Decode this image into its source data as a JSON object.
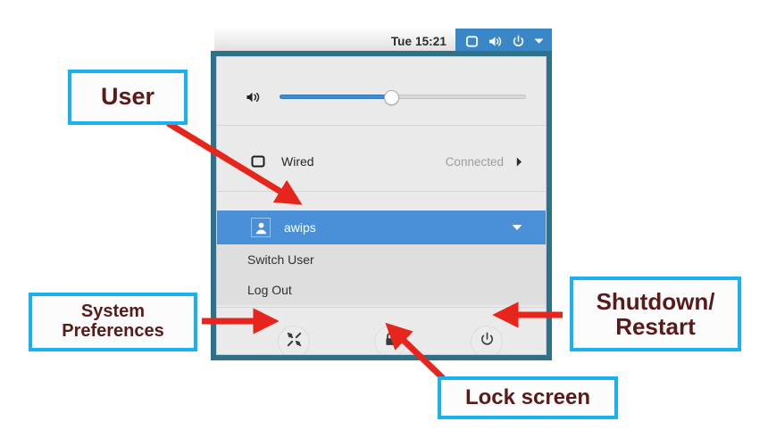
{
  "topbar": {
    "clock": "Tue 15:21",
    "indicators": [
      {
        "name": "network-monitor-icon",
        "label": "network"
      },
      {
        "name": "volume-speaker-icon",
        "label": "volume"
      },
      {
        "name": "power-icon",
        "label": "power"
      },
      {
        "name": "chevron-down-icon",
        "label": "menu"
      }
    ]
  },
  "menu": {
    "volume": {
      "icon_name": "speaker-icon",
      "level_percent": 45
    },
    "network": {
      "icon_name": "wired-network-icon",
      "label": "Wired",
      "status": "Connected",
      "arrow_icon": "chevron-right-icon"
    },
    "user": {
      "avatar_icon": "user-avatar-icon",
      "name": "awips",
      "expand_icon": "chevron-down-icon",
      "submenu": [
        {
          "label": "Switch User"
        },
        {
          "label": "Log Out"
        }
      ]
    },
    "actions": [
      {
        "name": "system-preferences-button",
        "icon": "tools-icon",
        "title": "System Preferences"
      },
      {
        "name": "lock-screen-button",
        "icon": "lock-icon",
        "title": "Lock Screen"
      },
      {
        "name": "shutdown-button",
        "icon": "power-icon",
        "title": "Shutdown"
      }
    ]
  },
  "annotations": {
    "user": "User",
    "system_preferences_line1": "System",
    "system_preferences_line2": "Preferences",
    "shutdown_line1": "Shutdown/",
    "shutdown_line2": "Restart",
    "lock_screen": "Lock screen"
  },
  "colors": {
    "accent_blue": "#4a90d9",
    "indicator_blue": "#3a87c8",
    "panel_border_teal": "#2f7287",
    "callout_border": "#18b2ef",
    "callout_text": "#5b1a1a",
    "arrow_red": "#e8251c",
    "menu_bg": "#eaeaea",
    "submenu_bg": "#dededf"
  }
}
